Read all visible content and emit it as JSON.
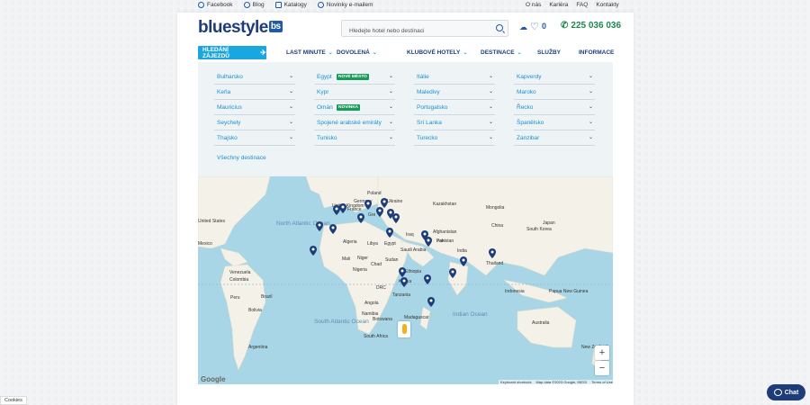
{
  "topbar": {
    "left": [
      {
        "label": "Facebook",
        "icon": "facebook-icon"
      },
      {
        "label": "Blog",
        "icon": "blog-icon"
      },
      {
        "label": "Katalogy",
        "icon": "catalog-icon"
      },
      {
        "label": "Novinky e-mailem",
        "icon": "email-icon"
      }
    ],
    "right": [
      "O nás",
      "Kariéra",
      "FAQ",
      "Kontakty"
    ]
  },
  "header": {
    "logo_text": "bluestyle",
    "logo_badge": "bs",
    "search_placeholder": "Hledejte hotel nebo destinaci",
    "favorites_count": "0",
    "phone": "225 036 036"
  },
  "nav": {
    "search_button": "HLEDÁNÍ ZÁJEZDŮ",
    "items": [
      "LAST MINUTE",
      "DOVOLENÁ",
      "KLUBOVÉ HOTELY",
      "DESTINACE",
      "SLUŽBY",
      "INFORMACE"
    ]
  },
  "destinations": {
    "items": [
      {
        "label": "Bulharsko"
      },
      {
        "label": "Egypt",
        "badge": "NOVÉ MĚSTO"
      },
      {
        "label": "Itálie"
      },
      {
        "label": "Kapverdy"
      },
      {
        "label": "Keňa"
      },
      {
        "label": "Kypr"
      },
      {
        "label": "Maledivy"
      },
      {
        "label": "Maroko"
      },
      {
        "label": "Mauricius"
      },
      {
        "label": "Omán",
        "badge": "NOVINKA"
      },
      {
        "label": "Portugalsko"
      },
      {
        "label": "Řecko"
      },
      {
        "label": "Seychely"
      },
      {
        "label": "Spojené arabské emiráty"
      },
      {
        "label": "Srí Lanka"
      },
      {
        "label": "Španělsko"
      },
      {
        "label": "Thajsko"
      },
      {
        "label": "Tunisko"
      },
      {
        "label": "Turecko"
      },
      {
        "label": "Zanzibar"
      }
    ],
    "all_label": "Všechny destinace",
    "badge_color": "#1a9a5a"
  },
  "map": {
    "labels": [
      "North Atlantic Ocean",
      "South Atlantic Ocean",
      "Indian Ocean",
      "United Kingdom",
      "Poland",
      "Ukraine",
      "Kazakhstan",
      "Mongolia",
      "China",
      "Japan",
      "South Korea",
      "Germany",
      "France",
      "Iran",
      "Iraq",
      "Afghanistan",
      "Pakistan",
      "Saudi Arabia",
      "Egypt",
      "Libya",
      "Algeria",
      "Mali",
      "Niger",
      "Chad",
      "Sudan",
      "Nigeria",
      "Ethiopia",
      "Kenya",
      "Tanzania",
      "DRC",
      "Angola",
      "Namibia",
      "Botswana",
      "Madagascar",
      "South Africa",
      "India",
      "Thailand",
      "Indonesia",
      "Papua New Guinea",
      "Australia",
      "New Zealand",
      "Venezuela",
      "Colombia",
      "Peru",
      "Brazil",
      "Bolivia",
      "Argentina",
      "United States",
      "Mexico",
      "Gre"
    ],
    "footer": [
      "Keyboard shortcuts",
      "Map data ©2023 Google, INEGI",
      "Terms of Use"
    ],
    "google": "Google",
    "zoom_in": "+",
    "zoom_out": "−"
  },
  "chat": {
    "label": "Chat"
  },
  "cookies": {
    "label": "Cookies"
  },
  "colors": {
    "brand": "#1e3c7a",
    "accent": "#1aa6df",
    "phone": "#1a8a4b",
    "water": "#a9d6e6",
    "land": "#f4f1e8"
  }
}
